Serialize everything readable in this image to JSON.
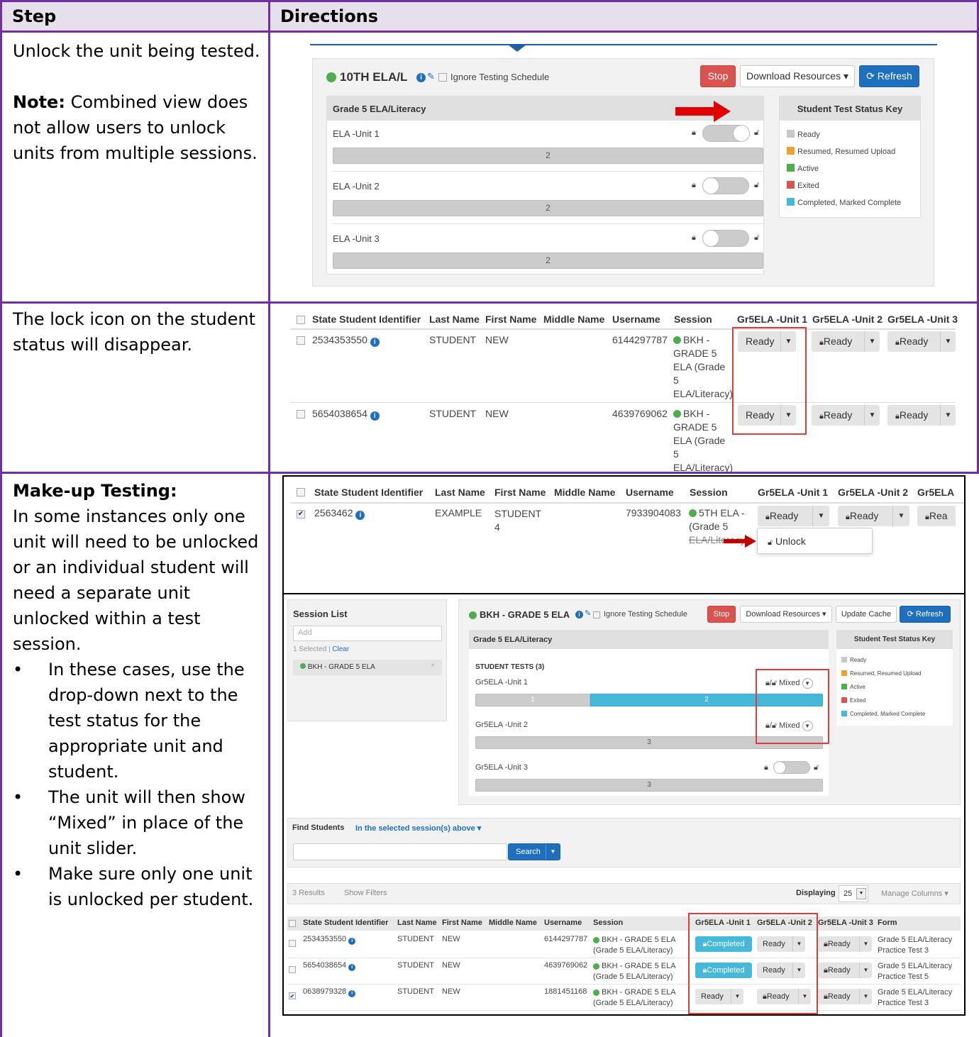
{
  "header": {
    "step": "Step",
    "directions": "Directions"
  },
  "row1": {
    "text": "Unlock the unit being tested.",
    "note_label": "Note:",
    "note_text": "Combined view does not allow users to unlock units from multiple sessions.",
    "shot": {
      "session_title": "10TH ELA/L",
      "ignore_label": "Ignore Testing Schedule",
      "stop": "Stop",
      "download": "Download Resources ▾",
      "refresh": "Refresh",
      "test_name": "Grade 5 ELA/Literacy",
      "units": [
        {
          "name": "ELA -Unit 1",
          "count": "2"
        },
        {
          "name": "ELA -Unit 2",
          "count": "2"
        },
        {
          "name": "ELA -Unit 3",
          "count": "2"
        }
      ],
      "key_title": "Student Test Status Key",
      "key": [
        {
          "label": "Ready",
          "color": "#c8c8c8"
        },
        {
          "label": "Resumed, Resumed Upload",
          "color": "#f0a030"
        },
        {
          "label": "Active",
          "color": "#4cae4c"
        },
        {
          "label": "Exited",
          "color": "#d9534f"
        },
        {
          "label": "Completed, Marked Complete",
          "color": "#46b8da"
        }
      ]
    }
  },
  "row2": {
    "text": "The lock icon on the student status will disappear.",
    "shot": {
      "headers": [
        "State Student Identifier",
        "Last Name",
        "First Name",
        "Middle Name",
        "Username",
        "Session",
        "Gr5ELA -Unit 1",
        "Gr5ELA -Unit 2",
        "Gr5ELA -Unit 3"
      ],
      "rows": [
        {
          "id": "2534353550",
          "last": "STUDENT",
          "first": "NEW",
          "user": "6144297787",
          "session": [
            "BKH -",
            "GRADE 5",
            "ELA (Grade",
            "5",
            "ELA/Literacy)"
          ]
        },
        {
          "id": "5654038654",
          "last": "STUDENT",
          "first": "NEW",
          "user": "4639769062",
          "session": [
            "BKH -",
            "GRADE 5",
            "ELA (Grade",
            "5",
            "ELA/Literacy)"
          ]
        }
      ],
      "ready": "Ready"
    }
  },
  "row3": {
    "title": "Make-up Testing:",
    "intro": "In some instances only one unit will need to be unlocked or an individual student will need a separate unit unlocked within a test session.",
    "bullets": [
      "In these cases, use the drop-down next to the test status for the appropriate unit and student.",
      "The unit will then show “Mixed” in place of the unit slider.",
      "Make sure only one unit is unlocked per student."
    ],
    "shot1": {
      "headers": [
        "State Student Identifier",
        "Last Name",
        "First Name",
        "Middle Name",
        "Username",
        "Session",
        "Gr5ELA -Unit 1",
        "Gr5ELA -Unit 2",
        "Gr5ELA"
      ],
      "id": "2563462",
      "last": "EXAMPLE",
      "first": "STUDENT",
      "first2": "4",
      "user": "7933904083",
      "session": [
        "5TH ELA -",
        "(Grade 5",
        "ELA/Literacy)"
      ],
      "ready": "Ready",
      "partial": "Rea",
      "unlock": "Unlock"
    },
    "shot2": {
      "session_list": "Session List",
      "add": "Add",
      "selected": "1 Selected | ",
      "clear": "Clear",
      "session_item": "BKH - GRADE 5 ELA",
      "close": "×",
      "session_title": "BKH - GRADE 5 ELA",
      "ignore_label": "Ignore Testing Schedule",
      "stop": "Stop",
      "download": "Download Resources ▾",
      "update": "Update Cache",
      "refresh": "Refresh",
      "test_name": "Grade 5 ELA/Literacy",
      "student_tests": "STUDENT TESTS (3)",
      "units": [
        {
          "name": "Gr5ELA -Unit 1",
          "status": "Mixed",
          "seg1": "1",
          "seg2": "2"
        },
        {
          "name": "Gr5ELA -Unit 2",
          "status": "Mixed",
          "count": "3"
        },
        {
          "name": "Gr5ELA -Unit 3",
          "count": "3"
        }
      ],
      "key_title": "Student Test Status Key",
      "key": [
        "Ready",
        "Resumed, Resumed Upload",
        "Active",
        "Exited",
        "Completed, Marked Complete"
      ],
      "find_label": "Find Students",
      "find_scope": "In the selected session(s) above ▾",
      "search": "Search",
      "results": "3 Results",
      "filters": "Show Filters",
      "displaying": "Displaying",
      "per_page": "25",
      "manage": "Manage Columns ▾",
      "headers": [
        "State Student Identifier",
        "Last Name",
        "First Name",
        "Middle Name",
        "Username",
        "Session",
        "Gr5ELA -Unit 1",
        "Gr5ELA -Unit 2",
        "Gr5ELA -Unit 3",
        "Form"
      ],
      "rows": [
        {
          "id": "2534353550",
          "last": "STUDENT",
          "first": "NEW",
          "user": "6144297787",
          "s1": "BKH - GRADE 5 ELA",
          "s2": "(Grade 5 ELA/Literacy)",
          "u1": "Completed",
          "u2": "Ready",
          "u3": "Ready",
          "f1": "Grade 5 ELA/Literacy",
          "f2": "Practice Test 3",
          "checked": false
        },
        {
          "id": "5654038654",
          "last": "STUDENT",
          "first": "NEW",
          "user": "4639769062",
          "s1": "BKH - GRADE 5 ELA",
          "s2": "(Grade 5 ELA/Literacy)",
          "u1": "Completed",
          "u2": "Ready",
          "u3": "Ready",
          "f1": "Grade 5 ELA/Literacy",
          "f2": "Practice Test 5",
          "checked": false
        },
        {
          "id": "0638979328",
          "last": "STUDENT",
          "first": "NEW",
          "user": "1881451168",
          "s1": "BKH - GRADE 5 ELA",
          "s2": "(Grade 5 ELA/Literacy)",
          "u1": "Ready",
          "u2": "Ready",
          "u3": "Ready",
          "f1": "Grade 5 ELA/Literacy",
          "f2": "Practice Test 3",
          "checked": true
        }
      ]
    }
  }
}
